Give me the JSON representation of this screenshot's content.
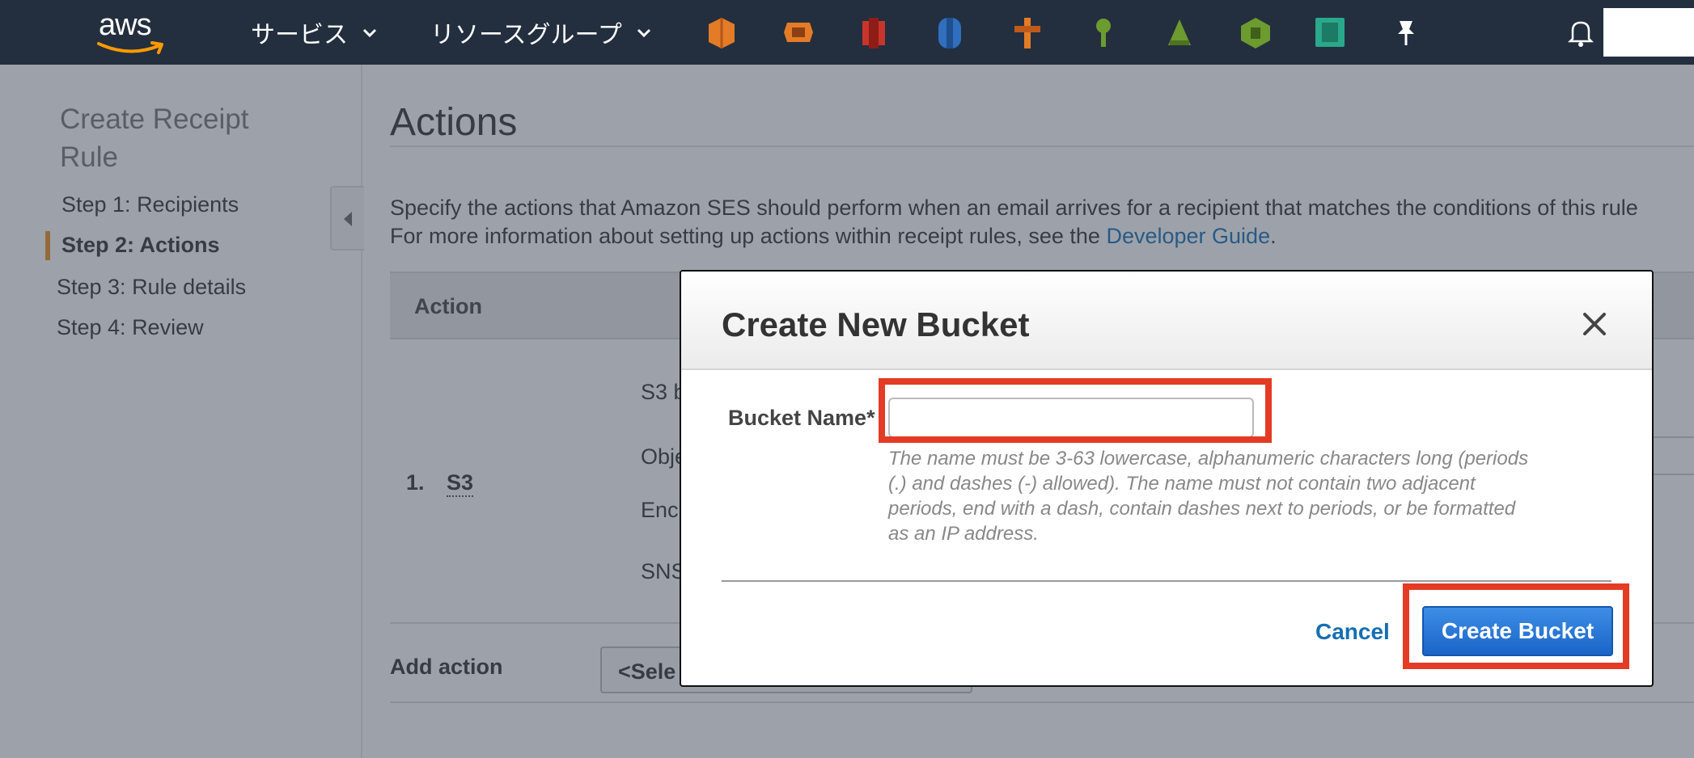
{
  "topnav": {
    "logo_text": "aws",
    "services_label": "サービス",
    "resource_groups_label": "リソースグループ"
  },
  "sidebar": {
    "title": "Create Receipt Rule",
    "steps": [
      {
        "label": "Step 1: Recipients"
      },
      {
        "label": "Step 2: Actions"
      },
      {
        "label": "Step 3: Rule details"
      },
      {
        "label": "Step 4: Review"
      }
    ]
  },
  "main": {
    "title": "Actions",
    "description_line1": "Specify the actions that Amazon SES should perform when an email arrives for a recipient that matches the conditions of this rule",
    "description_line2": "For more information about setting up actions within receipt rules, see the",
    "developer_guide_link": "Developer Guide",
    "description_end": ".",
    "table_header": "Action",
    "row_number": "1.",
    "row_action": "S3",
    "field_labels": [
      "S3 b",
      "Obje",
      "Enc",
      "SNS"
    ],
    "add_action_label": "Add action",
    "select_value": "<Sele"
  },
  "modal": {
    "title": "Create New Bucket",
    "field_label": "Bucket Name*",
    "input_value": "",
    "help_text": "The name must be 3-63 lowercase, alphanumeric characters long (periods (.) and dashes (-) allowed). The name must not contain two adjacent periods, end with a dash, contain dashes next to periods, or be formatted as an IP address.",
    "cancel_label": "Cancel",
    "create_label": "Create Bucket"
  },
  "colors": {
    "nav_bg": "#232f3e",
    "accent_orange": "#e8901d",
    "link_blue": "#146eb4",
    "highlight_red": "#e43b24",
    "button_blue": "#1a64c8"
  },
  "icons": [
    "aws-logo",
    "chevron-down-icon",
    "service-shortcut-icons",
    "pin-icon",
    "bell-icon",
    "collapse-arrow-icon",
    "close-icon"
  ]
}
